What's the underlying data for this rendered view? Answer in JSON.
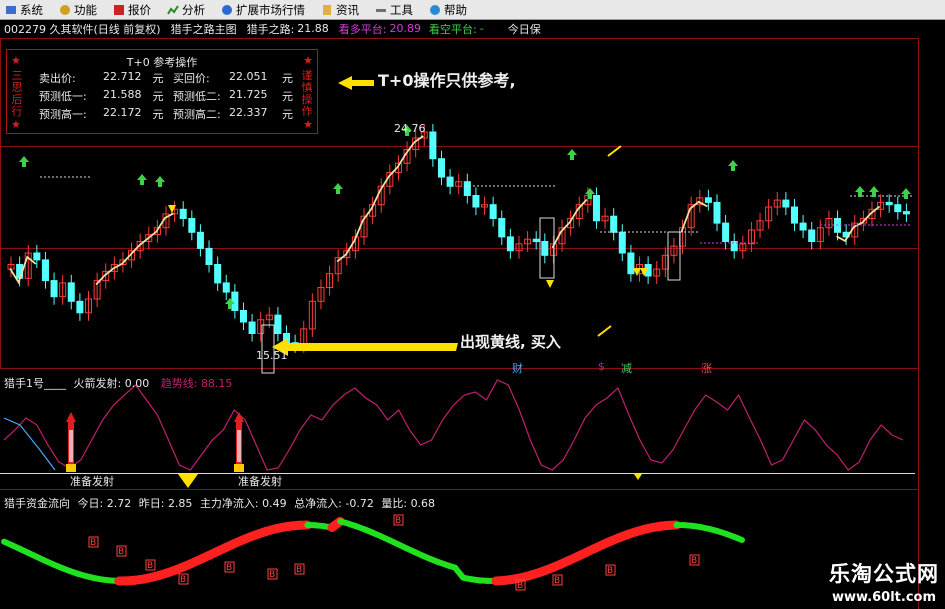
{
  "menu": [
    {
      "label": "系统",
      "icon": "system-icon"
    },
    {
      "label": "功能",
      "icon": "function-icon"
    },
    {
      "label": "报价",
      "icon": "quote-icon"
    },
    {
      "label": "分析",
      "icon": "analysis-icon"
    },
    {
      "label": "扩展市场行情",
      "icon": "market-icon"
    },
    {
      "label": "资讯",
      "icon": "info-icon"
    },
    {
      "label": "工具",
      "icon": "tools-icon"
    },
    {
      "label": "帮助",
      "icon": "help-icon"
    }
  ],
  "infobar": {
    "code_title": "002279 久其软件(日线 前复权)",
    "formula": "猎手之路主图",
    "hunter_label": "猎手之路:",
    "hunter_value": "21.88",
    "bull_label": "看多平台:",
    "bull_value": "20.89",
    "bear_label": "看空平台:",
    "bear_value": "-",
    "today_label": "今日保"
  },
  "t0": {
    "title": "T+0 参考操作",
    "left_side": "三思后行",
    "right_side": "谨慎操作",
    "rows": [
      {
        "l1": "卖出价:",
        "v1": "22.712",
        "u1": "元",
        "l2": "买回价:",
        "v2": "22.051",
        "u2": "元"
      },
      {
        "l1": "预测低一:",
        "v1": "21.588",
        "u1": "元",
        "l2": "预测低二:",
        "v2": "21.725",
        "u2": "元"
      },
      {
        "l1": "预测高一:",
        "v1": "22.172",
        "u1": "元",
        "l2": "预测高二:",
        "v2": "22.337",
        "u2": "元"
      }
    ],
    "note": "T+0操作只供参考,"
  },
  "main_chart": {
    "high_label": "24.76",
    "low_label": "15.51",
    "buy_note": "出现黄线, 买入",
    "legend": [
      {
        "text": "财",
        "color": "#4aa8ff"
      },
      {
        "text": "$",
        "color": "#c0208a"
      },
      {
        "text": "减",
        "color": "#40d060"
      },
      {
        "text": "涨",
        "color": "#ff4040"
      }
    ]
  },
  "indicator1": {
    "name": "猎手1号",
    "rocket_label": "火箭发射:",
    "rocket_value": "0.00",
    "trend_label": "趋势线:",
    "trend_value": "88.15",
    "signal_text": "准备发射"
  },
  "indicator2": {
    "name": "猎手资金流向",
    "today_label": "今日:",
    "today_value": "2.72",
    "yesterday_label": "昨日:",
    "yesterday_value": "2.85",
    "main_label": "主力净流入:",
    "main_value": "0.49",
    "total_label": "总净流入:",
    "total_value": "-0.72",
    "ratio_label": "量比:",
    "ratio_value": "0.68",
    "buy_marker": "B"
  },
  "watermark": {
    "title": "乐淘公式网",
    "url": "www.60lt.com"
  },
  "colors": {
    "up": "#ff3b3b",
    "down": "#54ffff",
    "green": "#3cd24a",
    "grid": "#8a0e12",
    "yellow": "#ffe000",
    "bull": "#d040d0",
    "bear": "#3cd24a"
  }
}
